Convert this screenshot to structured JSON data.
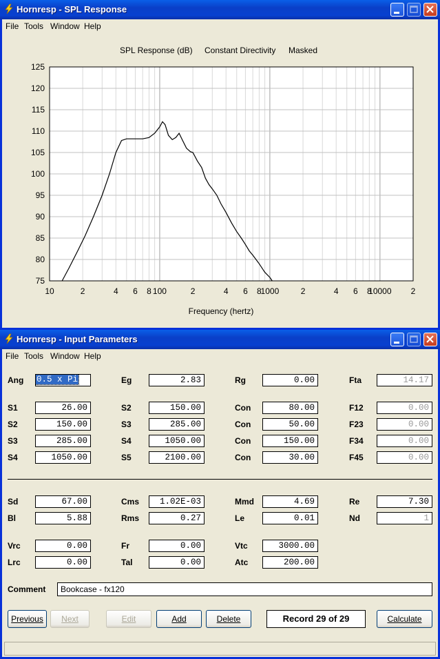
{
  "spl_window": {
    "title": "Hornresp - SPL Response",
    "menu": [
      "File",
      "Tools",
      "Window",
      "Help"
    ],
    "chart_title": [
      "SPL Response (dB)",
      "Constant Directivity",
      "Masked"
    ]
  },
  "chart_data": {
    "type": "line",
    "xlabel": "Frequency (hertz)",
    "ylabel": "",
    "title": "SPL Response (dB)   Constant Directivity   Masked",
    "x_scale": "log",
    "xlim": [
      10,
      20000
    ],
    "ylim": [
      75,
      125
    ],
    "yticks": [
      75,
      80,
      85,
      90,
      95,
      100,
      105,
      110,
      115,
      120,
      125
    ],
    "xtick_labels": [
      {
        "v": 10,
        "t": "10"
      },
      {
        "v": 20,
        "t": "2"
      },
      {
        "v": 40,
        "t": "4"
      },
      {
        "v": 60,
        "t": "6"
      },
      {
        "v": 80,
        "t": "8"
      },
      {
        "v": 100,
        "t": "100"
      },
      {
        "v": 200,
        "t": "2"
      },
      {
        "v": 400,
        "t": "4"
      },
      {
        "v": 600,
        "t": "6"
      },
      {
        "v": 800,
        "t": "8"
      },
      {
        "v": 1000,
        "t": "1000"
      },
      {
        "v": 2000,
        "t": "2"
      },
      {
        "v": 4000,
        "t": "4"
      },
      {
        "v": 6000,
        "t": "6"
      },
      {
        "v": 8000,
        "t": "8"
      },
      {
        "v": 10000,
        "t": "10000"
      },
      {
        "v": 20000,
        "t": "2"
      }
    ],
    "grid": true,
    "series": [
      {
        "name": "",
        "x": [
          13,
          15,
          18,
          21,
          25,
          30,
          35,
          40,
          45,
          50,
          60,
          70,
          80,
          90,
          100,
          106,
          112,
          120,
          130,
          140,
          150,
          160,
          175,
          190,
          200,
          220,
          240,
          260,
          280,
          300,
          330,
          360,
          400,
          450,
          500,
          550,
          600,
          650,
          700,
          800,
          900,
          1000,
          1050
        ],
        "y": [
          75,
          78,
          82,
          85.5,
          90,
          95,
          100,
          105,
          107.8,
          108.2,
          108.2,
          108.2,
          108.5,
          109.5,
          111,
          112.2,
          111.5,
          109,
          108,
          108.5,
          109.5,
          108,
          106,
          105.2,
          105,
          103,
          101.5,
          99,
          97.5,
          96.5,
          95,
          93,
          91,
          88.5,
          86.5,
          85,
          83.5,
          82,
          81,
          79,
          77,
          75.8,
          75
        ]
      }
    ]
  },
  "input_window": {
    "title": "Hornresp - Input Parameters",
    "menu": [
      "File",
      "Tools",
      "Window",
      "Help"
    ],
    "params": {
      "col1": [
        {
          "label": "Ang",
          "value": "0.5 x Pi"
        },
        {
          "label": "S1",
          "value": "26.00"
        },
        {
          "label": "S2",
          "value": "150.00"
        },
        {
          "label": "S3",
          "value": "285.00"
        },
        {
          "label": "S4",
          "value": "1050.00"
        },
        {
          "label": "Sd",
          "value": "67.00"
        },
        {
          "label": "Bl",
          "value": "5.88"
        },
        {
          "label": "Vrc",
          "value": "0.00"
        },
        {
          "label": "Lrc",
          "value": "0.00"
        }
      ],
      "col2": [
        {
          "label": "Eg",
          "value": "2.83"
        },
        {
          "label": "S2",
          "value": "150.00"
        },
        {
          "label": "S3",
          "value": "285.00"
        },
        {
          "label": "S4",
          "value": "1050.00"
        },
        {
          "label": "S5",
          "value": "2100.00"
        },
        {
          "label": "Cms",
          "value": "1.02E-03"
        },
        {
          "label": "Rms",
          "value": "0.27"
        },
        {
          "label": "Fr",
          "value": "0.00"
        },
        {
          "label": "Tal",
          "value": "0.00"
        }
      ],
      "col3": [
        {
          "label": "Rg",
          "value": "0.00"
        },
        {
          "label": "Con",
          "value": "80.00"
        },
        {
          "label": "Con",
          "value": "50.00"
        },
        {
          "label": "Con",
          "value": "150.00"
        },
        {
          "label": "Con",
          "value": "30.00"
        },
        {
          "label": "Mmd",
          "value": "4.69"
        },
        {
          "label": "Le",
          "value": "0.01"
        },
        {
          "label": "Vtc",
          "value": "3000.00"
        },
        {
          "label": "Atc",
          "value": "200.00"
        }
      ],
      "col4": [
        {
          "label": "Fta",
          "value": "14.17"
        },
        {
          "label": "F12",
          "value": "0.00"
        },
        {
          "label": "F23",
          "value": "0.00"
        },
        {
          "label": "F34",
          "value": "0.00"
        },
        {
          "label": "F45",
          "value": "0.00"
        },
        {
          "label": "Re",
          "value": "7.30"
        },
        {
          "label": "Nd",
          "value": "1"
        }
      ]
    },
    "comment_label": "Comment",
    "comment_value": "Bookcase - fx120",
    "buttons": {
      "previous": "Previous",
      "next": "Next",
      "edit": "Edit",
      "add": "Add",
      "delete": "Delete",
      "calculate": "Calculate"
    },
    "record": "Record 29 of 29"
  }
}
